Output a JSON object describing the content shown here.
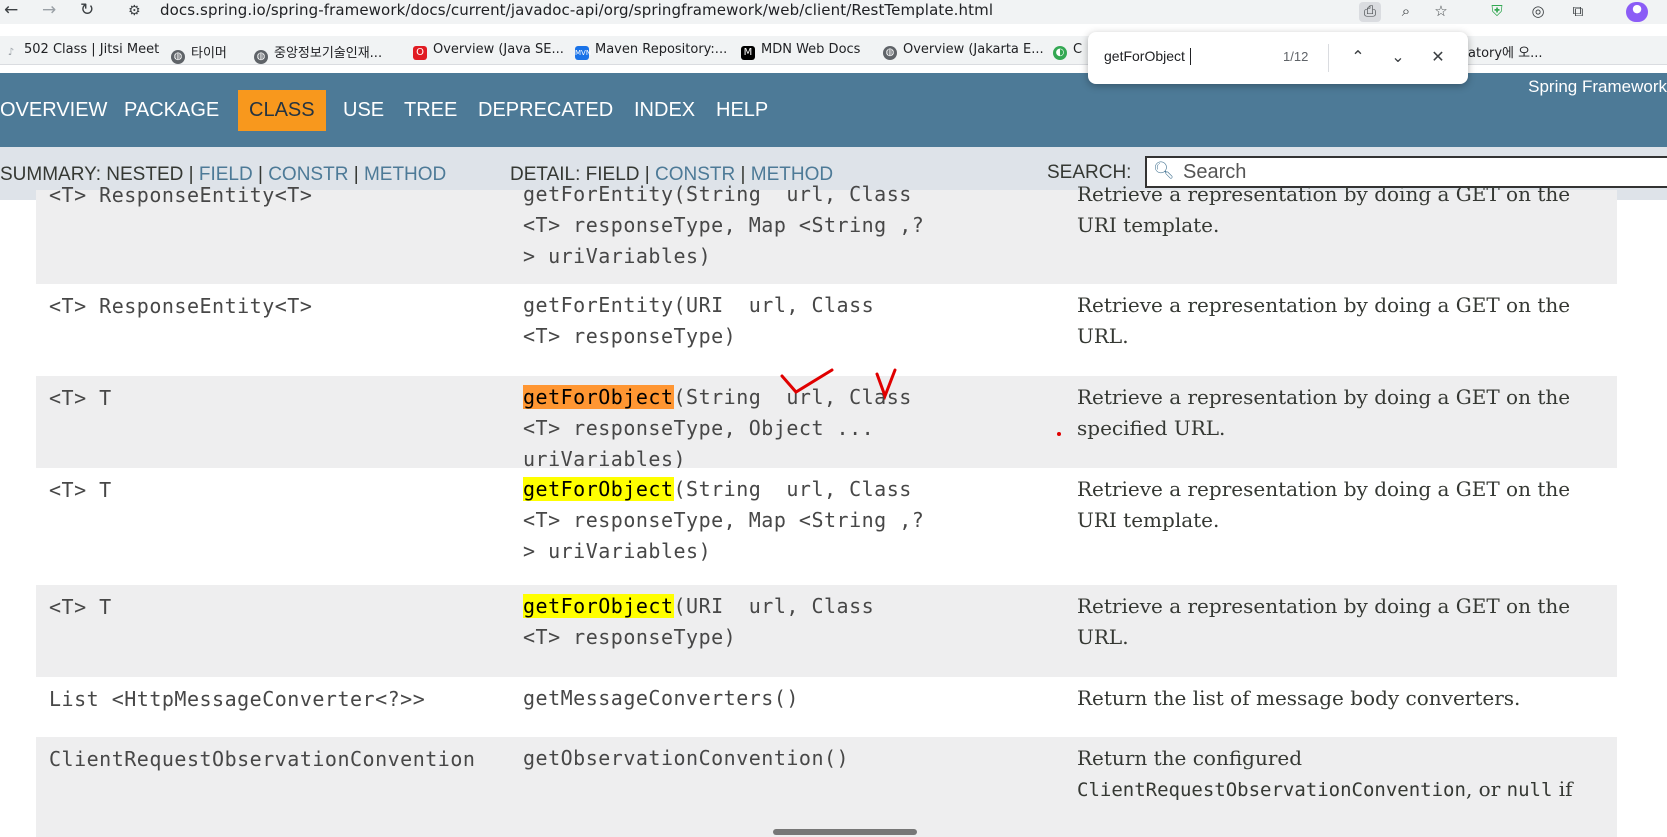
{
  "browser": {
    "url": "docs.spring.io/spring-framework/docs/current/javadoc-api/org/springframework/web/client/RestTemplate.html",
    "bookmarks": [
      {
        "label": "502 Class | Jitsi Meet",
        "icon": "jitsi-icon",
        "color": "#9aa0a6"
      },
      {
        "label": "타이머",
        "icon": "globe-icon",
        "color": "#5f6368"
      },
      {
        "label": "중앙정보기술인재...",
        "icon": "globe-icon",
        "color": "#5f6368"
      },
      {
        "label": "Overview (Java SE...",
        "icon": "oracle-icon",
        "color": "#e11b22"
      },
      {
        "label": "Maven Repository:...",
        "icon": "maven-icon",
        "color": "#1a73e8"
      },
      {
        "label": "MDN Web Docs",
        "icon": "mdn-icon",
        "color": "#000000"
      },
      {
        "label": "Overview (Jakarta E...",
        "icon": "globe-icon",
        "color": "#5f6368"
      },
      {
        "label": "C",
        "icon": "green-icon",
        "color": "#34a853"
      },
      {
        "label": "atory에 오...",
        "icon": "",
        "color": ""
      }
    ],
    "find": {
      "query": "getForObject",
      "count": "1/12"
    }
  },
  "topnav": {
    "items": [
      "OVERVIEW",
      "PACKAGE",
      "CLASS",
      "USE",
      "TREE",
      "DEPRECATED",
      "INDEX",
      "HELP"
    ],
    "brand": "Spring Framework"
  },
  "subnav": {
    "summary_label": "SUMMARY: NESTED |",
    "summary_links": [
      "FIELD",
      "CONSTR",
      "METHOD"
    ],
    "detail_label": "DETAIL:",
    "detail_links": [
      "FIELD",
      "CONSTR",
      "METHOD"
    ],
    "search_label": "SEARCH:",
    "search_placeholder": "Search"
  },
  "rows": [
    {
      "type": "<T> ResponseEntity<T>",
      "m1": "",
      "m2": "getForEntity(String  url, Class\n<T> responseType, Map <String ,?\n> uriVariables)",
      "desc": "Retrieve a representation by doing a GET on the URI template."
    },
    {
      "type": "<T> ResponseEntity<T>",
      "m1": "",
      "m2": "getForEntity(URI  url, Class\n<T> responseType)",
      "desc": "Retrieve a representation by doing a GET on the URL."
    },
    {
      "type": "<T> T",
      "m1": "getForObject",
      "m2": "(String  url, Class\n<T> responseType, Object ... uriVariables)",
      "desc": "Retrieve a representation by doing a GET on the specified URL."
    },
    {
      "type": "<T> T",
      "m1": "getForObject",
      "m2": "(String  url, Class\n<T> responseType, Map <String ,?\n> uriVariables)",
      "desc": "Retrieve a representation by doing a GET on the URI template."
    },
    {
      "type": "<T> T",
      "m1": "getForObject",
      "m2": "(URI  url, Class\n<T> responseType)",
      "desc": "Retrieve a representation by doing a GET on the URL."
    },
    {
      "type": "List <HttpMessageConverter<?>>",
      "m1": "",
      "m2": "getMessageConverters()",
      "desc": "Return the list of message body converters."
    },
    {
      "type": "ClientRequestObservationConvention",
      "m1": "",
      "m2": "getObservationConvention()",
      "desc": "Return the configured",
      "desc_code": "ClientRequestObservationConvention",
      "desc_mid": ", or ",
      "desc_null": "null",
      "desc_end": " if"
    }
  ],
  "colors": {
    "nav": "#4d7a97",
    "active": "#f8981d",
    "subnav": "#dee3e9",
    "current_match": "#ff9632",
    "match": "#ffff00",
    "annotation": "#e00000"
  }
}
